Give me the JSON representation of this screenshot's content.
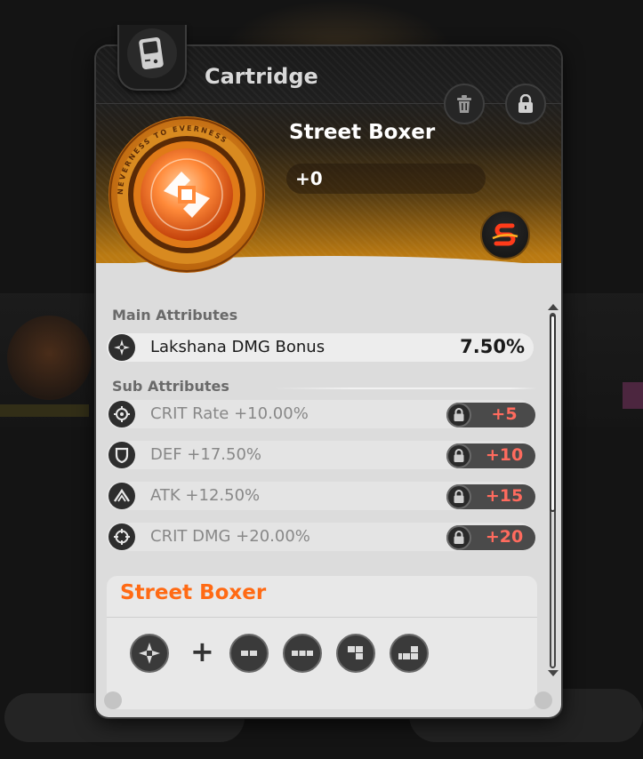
{
  "panel": {
    "title": "Cartridge",
    "item_name": "Street Boxer",
    "level": "+0"
  },
  "disc": {
    "ring_text": "NEVERNESS TO EVERNESS"
  },
  "main_attributes": {
    "label": "Main Attributes",
    "stat_name": "Lakshana DMG Bonus",
    "stat_value": "7.50%"
  },
  "sub_attributes": {
    "label": "Sub Attributes",
    "items": [
      {
        "text": "CRIT Rate +10.00%",
        "roll": "+5",
        "icon": "crit-rate-icon"
      },
      {
        "text": "DEF +17.50%",
        "roll": "+10",
        "icon": "shield-icon"
      },
      {
        "text": "ATK +12.50%",
        "roll": "+15",
        "icon": "atk-icon"
      },
      {
        "text": "CRIT DMG +20.00%",
        "roll": "+20",
        "icon": "crit-dmg-icon"
      }
    ]
  },
  "set": {
    "title": "Street Boxer",
    "plus": "+"
  },
  "colors": {
    "accent_orange": "#ff6a14",
    "roll_red": "#ff6b5e",
    "header_gold": "#d58c10"
  }
}
